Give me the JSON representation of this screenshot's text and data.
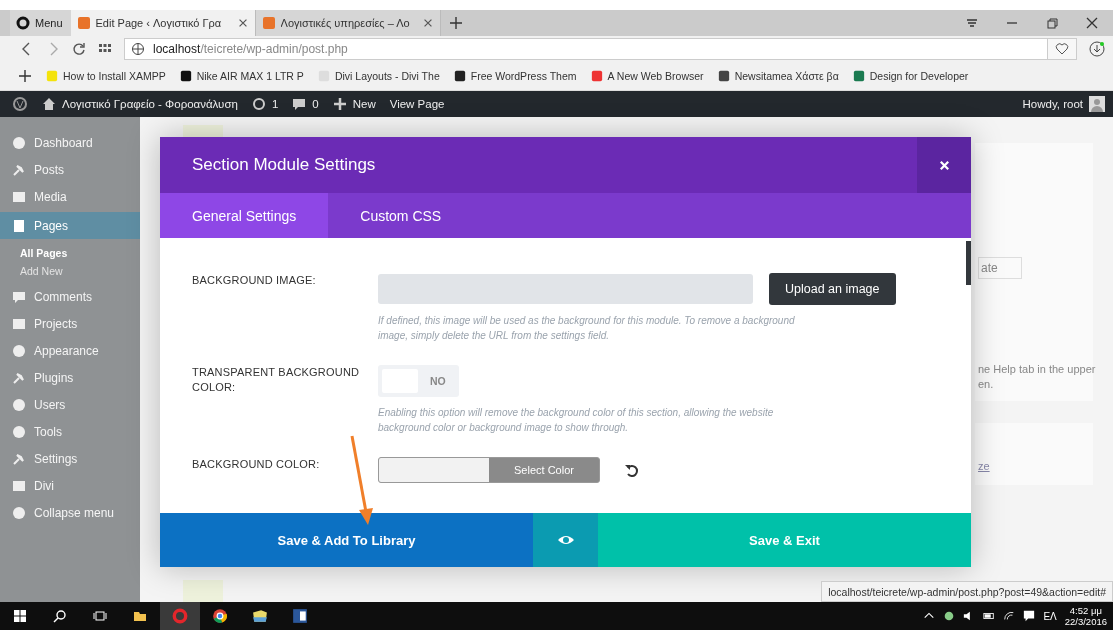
{
  "browser": {
    "menu_label": "Menu",
    "tabs": [
      {
        "label": "Edit Page ‹ Λογιστικό Γρα",
        "selected": true
      },
      {
        "label": "Λογιστικές υπηρεσίες – Λο",
        "selected": false
      }
    ],
    "address": {
      "host": "localhost",
      "path": "/teicrete/wp-admin/post.php"
    },
    "bookmarks": [
      "How to Install XAMPP",
      "Nike AIR MAX 1 LTR P",
      "Divi Layouts - Divi The",
      "Free WordPress Them",
      "A New Web Browser",
      "Newsitamea Χάστε βα",
      "Design for Developer"
    ]
  },
  "admin_bar": {
    "site_name": "Λογιστικό Γραφείο - Φοροανάλυση",
    "updates": "1",
    "comments": "0",
    "new": "New",
    "view": "View Page",
    "howdy": "Howdy, root"
  },
  "sidebar": {
    "items": [
      {
        "label": "Dashboard",
        "selected": false
      },
      {
        "label": "Posts",
        "selected": false
      },
      {
        "label": "Media",
        "selected": false
      },
      {
        "label": "Pages",
        "selected": true,
        "children": [
          {
            "label": "All Pages",
            "selected": true
          },
          {
            "label": "Add New",
            "selected": false
          }
        ]
      },
      {
        "label": "Comments",
        "selected": false
      },
      {
        "label": "Projects",
        "selected": false
      },
      {
        "label": "Appearance",
        "selected": false
      },
      {
        "label": "Plugins",
        "selected": false
      },
      {
        "label": "Users",
        "selected": false
      },
      {
        "label": "Tools",
        "selected": false
      },
      {
        "label": "Settings",
        "selected": false
      },
      {
        "label": "Divi",
        "selected": false
      },
      {
        "label": "Collapse menu",
        "selected": false
      }
    ]
  },
  "background_panel": {
    "dropdown_text": "ate",
    "help_lines": [
      "ne Help tab in the upper",
      "en."
    ],
    "link": "ze"
  },
  "modal": {
    "title": "Section Module Settings",
    "tabs": [
      {
        "label": "General Settings",
        "selected": true
      },
      {
        "label": "Custom CSS",
        "selected": false
      }
    ],
    "fields": [
      {
        "kind": "upload",
        "label": "BACKGROUND IMAGE:",
        "button": "Upload an image",
        "help": "If defined, this image will be used as the background for this module. To remove a background image, simply delete the URL from the settings field."
      },
      {
        "kind": "toggle",
        "label": "TRANSPARENT BACKGROUND COLOR:",
        "on": false,
        "state_label": "NO",
        "help": "Enabling this option will remove the background color of this section, allowing the website background color or background image to show through."
      },
      {
        "kind": "color",
        "label": "BACKGROUND COLOR:",
        "button": "Select Color"
      }
    ],
    "footer": {
      "save_library": "Save & Add To Library",
      "save_exit": "Save & Exit"
    }
  },
  "status_url": "localhost/teicrete/wp-admin/post.php?post=49&action=edit#",
  "taskbar": {
    "language": "ΕΛ",
    "time": "4:52 μμ",
    "date": "22/3/2016"
  }
}
